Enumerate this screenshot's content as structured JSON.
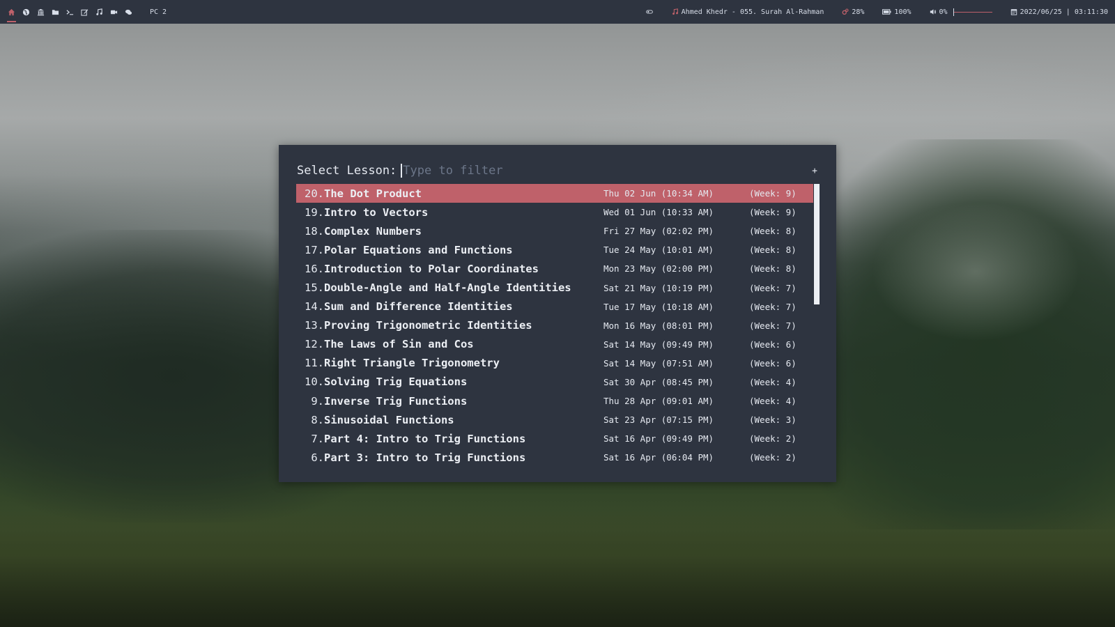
{
  "topbar": {
    "workspaces": [
      {
        "icon": "home-icon",
        "active": true
      },
      {
        "icon": "globe-icon",
        "active": false
      },
      {
        "icon": "university-icon",
        "active": false
      },
      {
        "icon": "folder-icon",
        "active": false
      },
      {
        "icon": "terminal-icon",
        "active": false
      },
      {
        "icon": "edit-icon",
        "active": false
      },
      {
        "icon": "music-note-icon",
        "active": false
      },
      {
        "icon": "video-camera-icon",
        "active": false
      },
      {
        "icon": "chat-icon",
        "active": false
      }
    ],
    "pc_label": "PC 2",
    "now_playing": "Ahmed Khedr - 055. Surah Al-Rahman",
    "cpu": "28%",
    "battery": "100%",
    "volume": "0%",
    "datetime": "2022/06/25 | 03:11:30",
    "accent_color": "#bf616a"
  },
  "launcher": {
    "prompt": "Select Lesson:",
    "placeholder": "Type to filter",
    "filter_value": "",
    "add_label": "+",
    "selected_index": 0,
    "lessons": [
      {
        "num": "20.",
        "title": "The Dot Product",
        "date": "Thu 02 Jun (10:34 AM)",
        "week": "(Week: 9)"
      },
      {
        "num": "19.",
        "title": "Intro to Vectors",
        "date": "Wed 01 Jun (10:33 AM)",
        "week": "(Week: 9)"
      },
      {
        "num": "18.",
        "title": "Complex Numbers",
        "date": "Fri 27 May (02:02 PM)",
        "week": "(Week: 8)"
      },
      {
        "num": "17.",
        "title": "Polar Equations and Functions",
        "date": "Tue 24 May (10:01 AM)",
        "week": "(Week: 8)"
      },
      {
        "num": "16.",
        "title": "Introduction to Polar Coordinates",
        "date": "Mon 23 May (02:00 PM)",
        "week": "(Week: 8)"
      },
      {
        "num": "15.",
        "title": "Double-Angle and Half-Angle Identities",
        "date": "Sat 21 May (10:19 PM)",
        "week": "(Week: 7)"
      },
      {
        "num": "14.",
        "title": "Sum and Difference Identities",
        "date": "Tue 17 May (10:18 AM)",
        "week": "(Week: 7)"
      },
      {
        "num": "13.",
        "title": "Proving Trigonometric Identities",
        "date": "Mon 16 May (08:01 PM)",
        "week": "(Week: 7)"
      },
      {
        "num": "12.",
        "title": "The Laws of Sin and Cos",
        "date": "Sat 14 May (09:49 PM)",
        "week": "(Week: 6)"
      },
      {
        "num": "11.",
        "title": "Right Triangle Trigonometry",
        "date": "Sat 14 May (07:51 AM)",
        "week": "(Week: 6)"
      },
      {
        "num": "10.",
        "title": "Solving Trig Equations",
        "date": "Sat 30 Apr (08:45 PM)",
        "week": "(Week: 4)"
      },
      {
        "num": "9.",
        "title": "Inverse Trig Functions",
        "date": "Thu 28 Apr (09:01 AM)",
        "week": "(Week: 4)"
      },
      {
        "num": "8.",
        "title": "Sinusoidal Functions",
        "date": "Sat 23 Apr (07:15 PM)",
        "week": "(Week: 3)"
      },
      {
        "num": "7.",
        "title": "Part 4: Intro to Trig Functions",
        "date": "Sat 16 Apr (09:49 PM)",
        "week": "(Week: 2)"
      },
      {
        "num": "6.",
        "title": "Part 3: Intro to Trig Functions",
        "date": "Sat 16 Apr (06:04 PM)",
        "week": "(Week: 2)"
      }
    ]
  }
}
